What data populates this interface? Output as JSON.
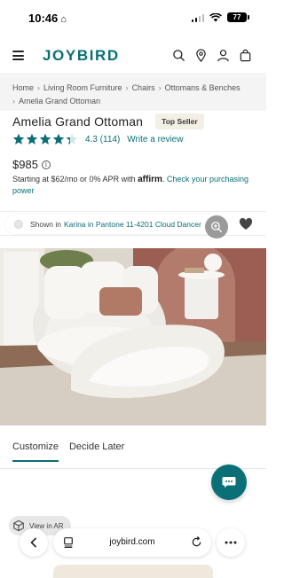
{
  "status_bar": {
    "time": "10:46",
    "battery": "77"
  },
  "header": {
    "logo": "JOYBIRD"
  },
  "breadcrumb": [
    "Home",
    "Living Room Furniture",
    "Chairs",
    "Ottomans & Benches",
    "Amelia Grand Ottoman"
  ],
  "product": {
    "title": "Amelia Grand Ottoman",
    "badge": "Top Seller",
    "rating": 4.3,
    "rating_text": "4.3 (114)",
    "review_link": "Write a review",
    "price": "$985",
    "finance_prefix": "Starting at $62/mo or 0% APR with",
    "finance_brand": "affirm",
    "finance_link": "Check your purchasing power"
  },
  "swatch": {
    "prefix": "Shown in",
    "name": "Karina in Pantone 11-4201 Cloud Dancer",
    "color": "#efece6"
  },
  "tabs": [
    {
      "label": "Customize",
      "active": true
    },
    {
      "label": "Decide Later",
      "active": false
    }
  ],
  "ar_button": {
    "label": "View in AR"
  },
  "browser": {
    "url": "joybird.com"
  },
  "colors": {
    "brand": "#0a6f77",
    "badge_bg": "#f4efe4",
    "star": "#0a6f77"
  },
  "icons": [
    "home-icon",
    "signal-icon",
    "wifi-icon",
    "battery-icon",
    "menu-icon",
    "search-icon",
    "location-pin-icon",
    "account-icon",
    "cart-icon",
    "star-icon",
    "info-icon",
    "zoom-in-icon",
    "heart-icon",
    "chat-icon",
    "ar-cube-icon",
    "back-arrow-icon",
    "tabs-icon",
    "reload-icon",
    "more-icon"
  ]
}
